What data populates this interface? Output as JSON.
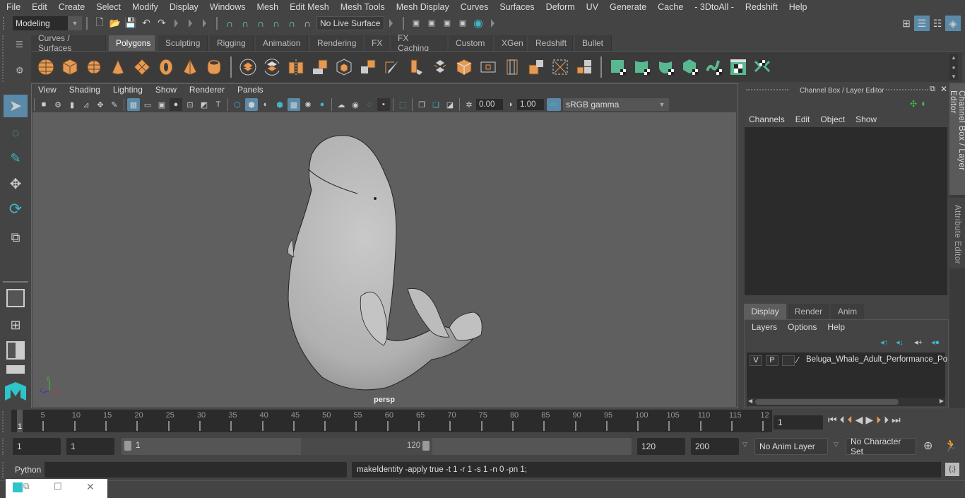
{
  "menubar": {
    "items": [
      "File",
      "Edit",
      "Create",
      "Select",
      "Modify",
      "Display",
      "Windows",
      "Mesh",
      "Edit Mesh",
      "Mesh Tools",
      "Mesh Display",
      "Curves",
      "Surfaces",
      "Deform",
      "UV",
      "Generate",
      "Cache",
      "- 3DtoAll -",
      "Redshift",
      "Help"
    ]
  },
  "statusline": {
    "mode": "Modeling",
    "live_surface": "No Live Surface"
  },
  "shelf": {
    "tabs": [
      "Curves / Surfaces",
      "Polygons",
      "Sculpting",
      "Rigging",
      "Animation",
      "Rendering",
      "FX",
      "FX Caching",
      "Custom",
      "XGen",
      "Redshift",
      "Bullet"
    ],
    "active_tab": "Polygons"
  },
  "viewport": {
    "menu": [
      "View",
      "Shading",
      "Lighting",
      "Show",
      "Renderer",
      "Panels"
    ],
    "exposure": "0.00",
    "gamma": "1.00",
    "color_mgmt_toggle": "ON",
    "color_space": "sRGB gamma",
    "camera_label": "persp",
    "axis": {
      "x": "x",
      "y": "y",
      "z": "z"
    }
  },
  "channel_box": {
    "title": "Channel Box / Layer Editor",
    "menu": [
      "Channels",
      "Edit",
      "Object",
      "Show"
    ]
  },
  "layer_editor": {
    "tabs": [
      "Display",
      "Render",
      "Anim"
    ],
    "active_tab": "Display",
    "menu": [
      "Layers",
      "Options",
      "Help"
    ],
    "layers": [
      {
        "v": "V",
        "p": "P",
        "name": "Beluga_Whale_Adult_Performance_Po"
      }
    ]
  },
  "side_tabs": [
    "Channel Box / Layer Editor",
    "Attribute Editor"
  ],
  "timeline": {
    "ticks": [
      5,
      10,
      15,
      20,
      25,
      30,
      35,
      40,
      45,
      50,
      55,
      60,
      65,
      70,
      75,
      80,
      85,
      90,
      95,
      100,
      105,
      110,
      115,
      "12"
    ],
    "current_frame_marker": "1",
    "current_frame": "1"
  },
  "range": {
    "start": "1",
    "playback_start": "1",
    "slider_start": "1",
    "slider_end": "120",
    "playback_end": "120",
    "end": "200",
    "anim_layer": "No Anim Layer",
    "character_set": "No Character Set"
  },
  "command_line": {
    "language": "Python",
    "input": "",
    "result": "makeIdentity -apply true -t 1 -r 1 -s 1 -n 0 -pn 1;"
  },
  "colors": {
    "accent": "#5b8aa8",
    "shelf_orange": "#e49a55",
    "shelf_green": "#5ab891",
    "teal": "#3fb5c4"
  }
}
